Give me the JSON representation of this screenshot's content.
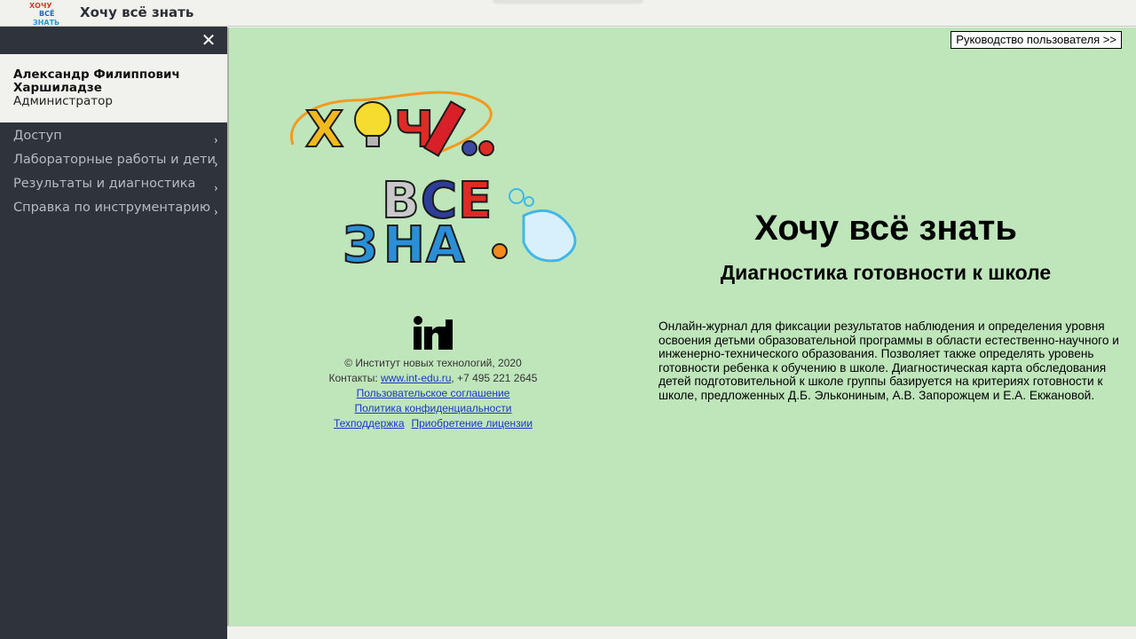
{
  "topbar": {
    "app_title": "Хочу всё знать",
    "logo_icon": "hochu-vse-znat-logo-icon"
  },
  "sidebar": {
    "close_symbol": "✕",
    "user": {
      "name": "Александр Филиппович Харшиладзе",
      "role": "Администратор"
    },
    "items": [
      {
        "label": "Доступ",
        "icon": "chevron-right-icon"
      },
      {
        "label": "Лабораторные работы и дети",
        "icon": "chevron-right-icon"
      },
      {
        "label": "Результаты и диагностика",
        "icon": "chevron-right-icon"
      },
      {
        "label": "Справка по инструментарию",
        "icon": "chevron-right-icon"
      }
    ],
    "chevron": "›"
  },
  "main": {
    "manual_button": "Руководство пользователя >>",
    "hero_logo": "hochu-vse-znat-logo",
    "title": "Хочу всё знать",
    "subtitle": "Диагностика готовности к школе",
    "description": "Онлайн-журнал для фиксации результатов наблюдения и определения уровня освоения детьми образовательной программы в области естественно-научного и инженерно-технического образования. Позволяет также определять уровень готовности ребенка к обучению в школе. Диагностическая карта обследования детей подготовительной к школе группы базируется на критериях готовности к школе, предложенных Д.Б. Элькониным, А.В. Запорожцем и Е.А. Екжановой.",
    "footer": {
      "int_logo": "int-logo",
      "copyright": "© Институт новых технологий, 2020",
      "contacts_prefix": "Контакты: ",
      "contacts_link": "www.int-edu.ru",
      "contacts_phone": ", +7 495 221 2645",
      "user_agreement": "Пользовательское соглашение",
      "privacy_policy": "Политика конфиденциальности",
      "support": "Техподдержка",
      "license": "Приобретение лицензии"
    }
  },
  "colors": {
    "sidebar_bg": "#2f333b",
    "main_bg": "#bfe6bb",
    "link": "#1a35c9",
    "nav_text": "#b6bcc4"
  }
}
